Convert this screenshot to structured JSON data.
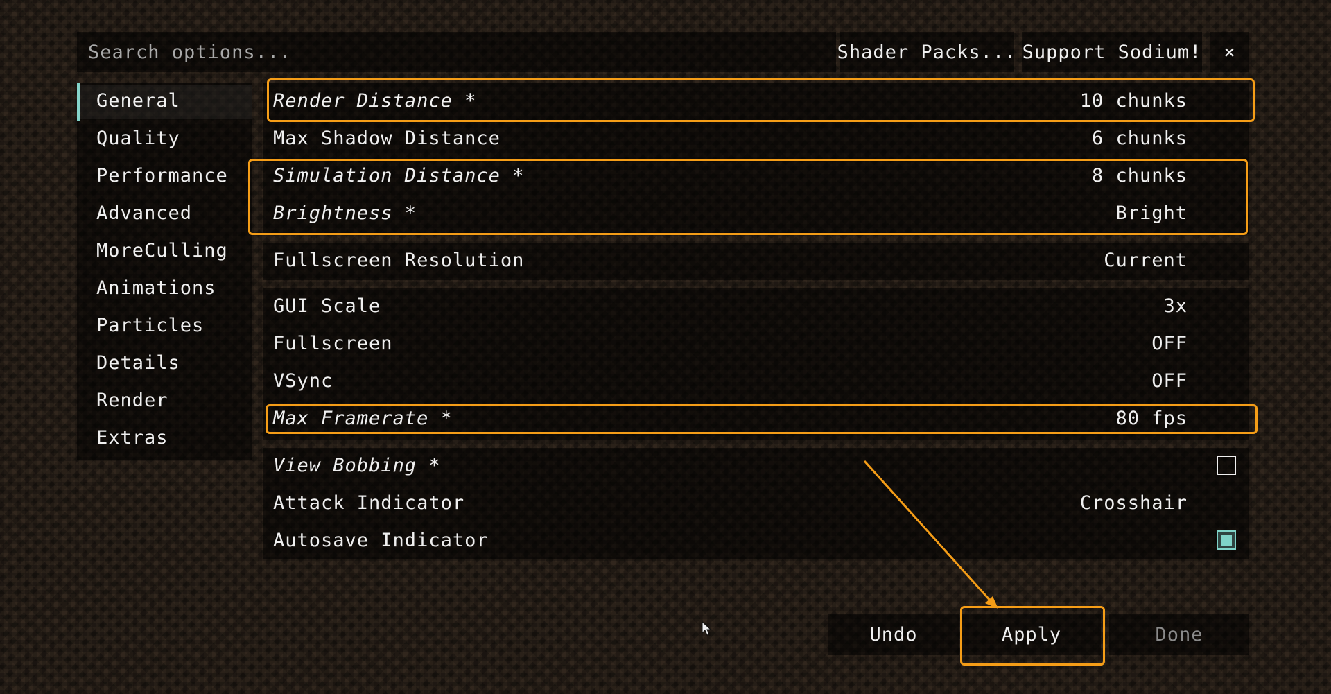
{
  "search": {
    "placeholder": "Search options..."
  },
  "top_buttons": {
    "shader_packs": "Shader Packs...",
    "support": "Support Sodium!",
    "close": "×"
  },
  "sidebar": {
    "items": [
      {
        "label": "General",
        "selected": true
      },
      {
        "label": "Quality"
      },
      {
        "label": "Performance"
      },
      {
        "label": "Advanced"
      },
      {
        "label": "MoreCulling"
      },
      {
        "label": "Animations"
      },
      {
        "label": "Particles"
      },
      {
        "label": "Details"
      },
      {
        "label": "Render"
      },
      {
        "label": "Extras"
      }
    ]
  },
  "options": {
    "render_distance": {
      "label": "Render Distance *",
      "value": "10 chunks"
    },
    "max_shadow_distance": {
      "label": "Max Shadow Distance",
      "value": "6 chunks"
    },
    "simulation_distance": {
      "label": "Simulation Distance *",
      "value": "8 chunks"
    },
    "brightness": {
      "label": "Brightness *",
      "value": "Bright"
    },
    "fullscreen_resolution": {
      "label": "Fullscreen Resolution",
      "value": "Current"
    },
    "gui_scale": {
      "label": "GUI Scale",
      "value": "3x"
    },
    "fullscreen": {
      "label": "Fullscreen",
      "value": "OFF"
    },
    "vsync": {
      "label": "VSync",
      "value": "OFF"
    },
    "max_framerate": {
      "label": "Max Framerate *",
      "value": "80 fps"
    },
    "view_bobbing": {
      "label": "View Bobbing *",
      "checked": false
    },
    "attack_indicator": {
      "label": "Attack Indicator",
      "value": "Crosshair"
    },
    "autosave_indicator": {
      "label": "Autosave Indicator",
      "checked": true
    }
  },
  "bottom_buttons": {
    "undo": "Undo",
    "apply": "Apply",
    "done": "Done"
  },
  "colors": {
    "highlight": "#f59d17",
    "checkbox_on": "#7fd3c8",
    "accent_bar": "#7fd3c8"
  }
}
